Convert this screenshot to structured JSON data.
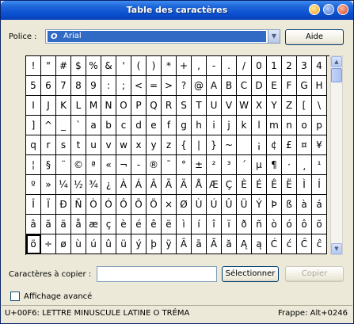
{
  "window": {
    "title": "Table des caractères"
  },
  "font": {
    "label": "Police :",
    "value": "Arial",
    "icon": "opentype-font-icon"
  },
  "help_button": "Aide",
  "characters": [
    "!",
    "\"",
    "#",
    "$",
    "%",
    "&",
    "'",
    "(",
    ")",
    "*",
    "+",
    ",",
    "-",
    ".",
    "/",
    "0",
    "1",
    "2",
    "3",
    "4",
    "5",
    "6",
    "7",
    "8",
    "9",
    ":",
    ";",
    "<",
    "=",
    ">",
    "?",
    "@",
    "A",
    "B",
    "C",
    "D",
    "E",
    "F",
    "G",
    "H",
    "I",
    "J",
    "K",
    "L",
    "M",
    "N",
    "O",
    "P",
    "Q",
    "R",
    "S",
    "T",
    "U",
    "V",
    "W",
    "X",
    "Y",
    "Z",
    "[",
    "\\",
    "]",
    "^",
    "_",
    "`",
    "a",
    "b",
    "c",
    "d",
    "e",
    "f",
    "g",
    "h",
    "i",
    "j",
    "k",
    "l",
    "m",
    "n",
    "o",
    "p",
    "q",
    "r",
    "s",
    "t",
    "u",
    "v",
    "w",
    "x",
    "y",
    "z",
    "{",
    "|",
    "}",
    "~",
    " ",
    "¡",
    "¢",
    "£",
    "¤",
    "¥",
    "¦",
    "§",
    "¨",
    "©",
    "ª",
    "«",
    "¬",
    "-",
    "®",
    "¯",
    "°",
    "±",
    "²",
    "³",
    "´",
    "µ",
    "¶",
    "·",
    "¸",
    "¹",
    "º",
    "»",
    "¼",
    "½",
    "¾",
    "¿",
    "À",
    "Á",
    "Â",
    "Ã",
    "Ä",
    "Å",
    "Æ",
    "Ç",
    "È",
    "É",
    "Ê",
    "Ë",
    "Ì",
    "Í",
    "Î",
    "Ï",
    "Ð",
    "Ñ",
    "Ò",
    "Ó",
    "Ô",
    "Õ",
    "Ö",
    "×",
    "Ø",
    "Ù",
    "Ú",
    "Û",
    "Ü",
    "Ý",
    "Þ",
    "ß",
    "à",
    "á",
    "â",
    "ã",
    "ä",
    "å",
    "æ",
    "ç",
    "è",
    "é",
    "ê",
    "ë",
    "ì",
    "í",
    "î",
    "ï",
    "ð",
    "ñ",
    "ò",
    "ó",
    "ô",
    "õ",
    "ö",
    "÷",
    "ø",
    "ù",
    "ú",
    "û",
    "ü",
    "ý",
    "þ",
    "ÿ",
    "Ā",
    "ā",
    "Ă",
    "ă",
    "Ą",
    "ą",
    "Ć",
    "ć",
    "Ĉ",
    "ĉ"
  ],
  "selected_index": 180,
  "copy": {
    "label": "Caractères à copier :",
    "value": "",
    "select_button": "Sélectionner",
    "copy_button": "Copier"
  },
  "advanced_view": {
    "label": "Affichage avancé",
    "checked": false
  },
  "status": {
    "char_info": "U+00F6: LETTRE MINUSCULE LATINE O TRÉMA",
    "keystroke": "Frappe: Alt+0246"
  },
  "colors": {
    "titlebar": "#0a4fd0",
    "selection": "#316ac5",
    "dialog": "#ece9d8"
  }
}
